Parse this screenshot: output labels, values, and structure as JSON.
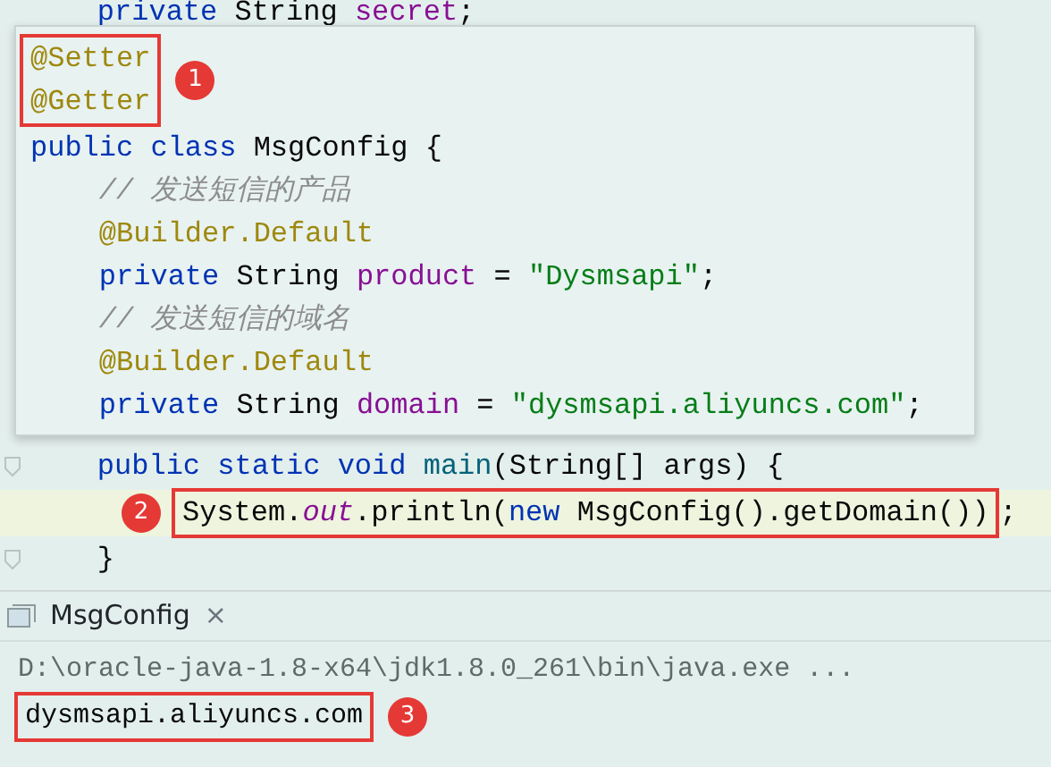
{
  "editor_top_line": [
    {
      "kind": "kw",
      "text": "    private "
    },
    {
      "kind": "plain",
      "text": "String "
    },
    {
      "kind": "field",
      "text": "secret"
    },
    {
      "kind": "plain",
      "text": ";"
    }
  ],
  "popup": {
    "annotated_block": {
      "badge": "1",
      "lines": [
        [
          {
            "kind": "ann",
            "text": "@Setter"
          }
        ],
        [
          {
            "kind": "ann",
            "text": "@Getter"
          }
        ]
      ]
    },
    "lines": [
      [
        {
          "kind": "kw",
          "text": "public class "
        },
        {
          "kind": "plain",
          "text": "MsgConfig {"
        }
      ],
      [
        {
          "kind": "comment",
          "text": "    // 发送短信的产品"
        }
      ],
      [
        {
          "kind": "ann",
          "text": "    @Builder.Default"
        }
      ],
      [
        {
          "kind": "kw",
          "text": "    private "
        },
        {
          "kind": "plain",
          "text": "String "
        },
        {
          "kind": "field",
          "text": "product"
        },
        {
          "kind": "plain",
          "text": " = "
        },
        {
          "kind": "str",
          "text": "\"Dysmsapi\""
        },
        {
          "kind": "plain",
          "text": ";"
        }
      ],
      [
        {
          "kind": "comment",
          "text": "    // 发送短信的域名"
        }
      ],
      [
        {
          "kind": "ann",
          "text": "    @Builder.Default"
        }
      ],
      [
        {
          "kind": "kw",
          "text": "    private "
        },
        {
          "kind": "plain",
          "text": "String "
        },
        {
          "kind": "field",
          "text": "domain"
        },
        {
          "kind": "plain",
          "text": " = "
        },
        {
          "kind": "str",
          "text": "\"dysmsapi.aliyuncs.com\""
        },
        {
          "kind": "plain",
          "text": ";"
        }
      ]
    ]
  },
  "editor": {
    "lines": [
      {
        "fold": true,
        "current": false,
        "tokens": [
          {
            "kind": "kw",
            "text": "    public static void "
          },
          {
            "kind": "method",
            "text": "main"
          },
          {
            "kind": "plain",
            "text": "(String[] args) {"
          }
        ]
      },
      {
        "fold": false,
        "current": true,
        "badge": "2",
        "tokens": [
          {
            "kind": "plain",
            "text": "System."
          },
          {
            "kind": "static",
            "text": "out"
          },
          {
            "kind": "plain",
            "text": ".println("
          },
          {
            "kind": "kw",
            "text": "new "
          },
          {
            "kind": "plain",
            "text": "MsgConfig().getDomain())"
          }
        ],
        "after": ";"
      },
      {
        "fold": true,
        "current": false,
        "tokens": [
          {
            "kind": "plain",
            "text": "    }"
          }
        ]
      }
    ]
  },
  "run_panel": {
    "tab": {
      "label": "MsgConfig",
      "close": "×"
    },
    "output": [
      {
        "text": "D:\\oracle-java-1.8-x64\\jdk1.8.0_261\\bin\\java.exe ...",
        "kind": "command"
      },
      {
        "text": "dysmsapi.aliyuncs.com",
        "kind": "result",
        "badge": "3"
      }
    ]
  }
}
